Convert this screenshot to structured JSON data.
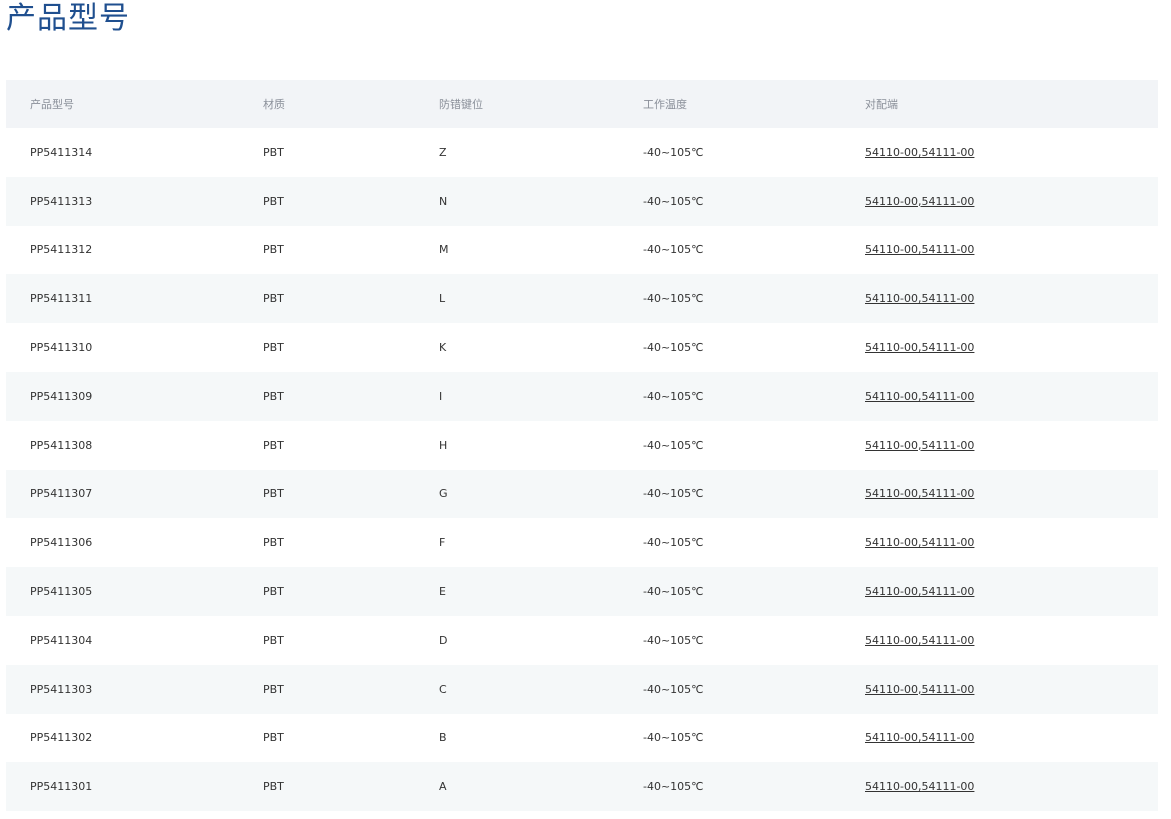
{
  "page": {
    "title": "产品型号"
  },
  "table": {
    "headers": [
      "产品型号",
      "材质",
      "防错键位",
      "工作温度",
      "对配端"
    ],
    "rows": [
      {
        "model": "PP5411314",
        "material": "PBT",
        "key": "Z",
        "temp": "-40~105℃",
        "mating_a": "54110-00",
        "mating_b": "54111-00"
      },
      {
        "model": "PP5411313",
        "material": "PBT",
        "key": "N",
        "temp": "-40~105℃",
        "mating_a": "54110-00",
        "mating_b": "54111-00"
      },
      {
        "model": "PP5411312",
        "material": "PBT",
        "key": "M",
        "temp": "-40~105℃",
        "mating_a": "54110-00",
        "mating_b": "54111-00"
      },
      {
        "model": "PP5411311",
        "material": "PBT",
        "key": "L",
        "temp": "-40~105℃",
        "mating_a": "54110-00",
        "mating_b": "54111-00"
      },
      {
        "model": "PP5411310",
        "material": "PBT",
        "key": "K",
        "temp": "-40~105℃",
        "mating_a": "54110-00",
        "mating_b": "54111-00"
      },
      {
        "model": "PP5411309",
        "material": "PBT",
        "key": "I",
        "temp": "-40~105℃",
        "mating_a": "54110-00",
        "mating_b": "54111-00"
      },
      {
        "model": "PP5411308",
        "material": "PBT",
        "key": "H",
        "temp": "-40~105℃",
        "mating_a": "54110-00",
        "mating_b": "54111-00"
      },
      {
        "model": "PP5411307",
        "material": "PBT",
        "key": "G",
        "temp": "-40~105℃",
        "mating_a": "54110-00",
        "mating_b": "54111-00"
      },
      {
        "model": "PP5411306",
        "material": "PBT",
        "key": "F",
        "temp": "-40~105℃",
        "mating_a": "54110-00",
        "mating_b": "54111-00"
      },
      {
        "model": "PP5411305",
        "material": "PBT",
        "key": "E",
        "temp": "-40~105℃",
        "mating_a": "54110-00",
        "mating_b": "54111-00"
      },
      {
        "model": "PP5411304",
        "material": "PBT",
        "key": "D",
        "temp": "-40~105℃",
        "mating_a": "54110-00",
        "mating_b": "54111-00"
      },
      {
        "model": "PP5411303",
        "material": "PBT",
        "key": "C",
        "temp": "-40~105℃",
        "mating_a": "54110-00",
        "mating_b": "54111-00"
      },
      {
        "model": "PP5411302",
        "material": "PBT",
        "key": "B",
        "temp": "-40~105℃",
        "mating_a": "54110-00",
        "mating_b": "54111-00"
      },
      {
        "model": "PP5411301",
        "material": "PBT",
        "key": "A",
        "temp": "-40~105℃",
        "mating_a": "54110-00",
        "mating_b": "54111-00"
      }
    ]
  },
  "colors": {
    "title": "#1f4f8f",
    "header_bg": "#f2f4f7",
    "row_alt_bg": "#f5f8f9",
    "text": "#333333",
    "header_text": "#8a8f99"
  }
}
